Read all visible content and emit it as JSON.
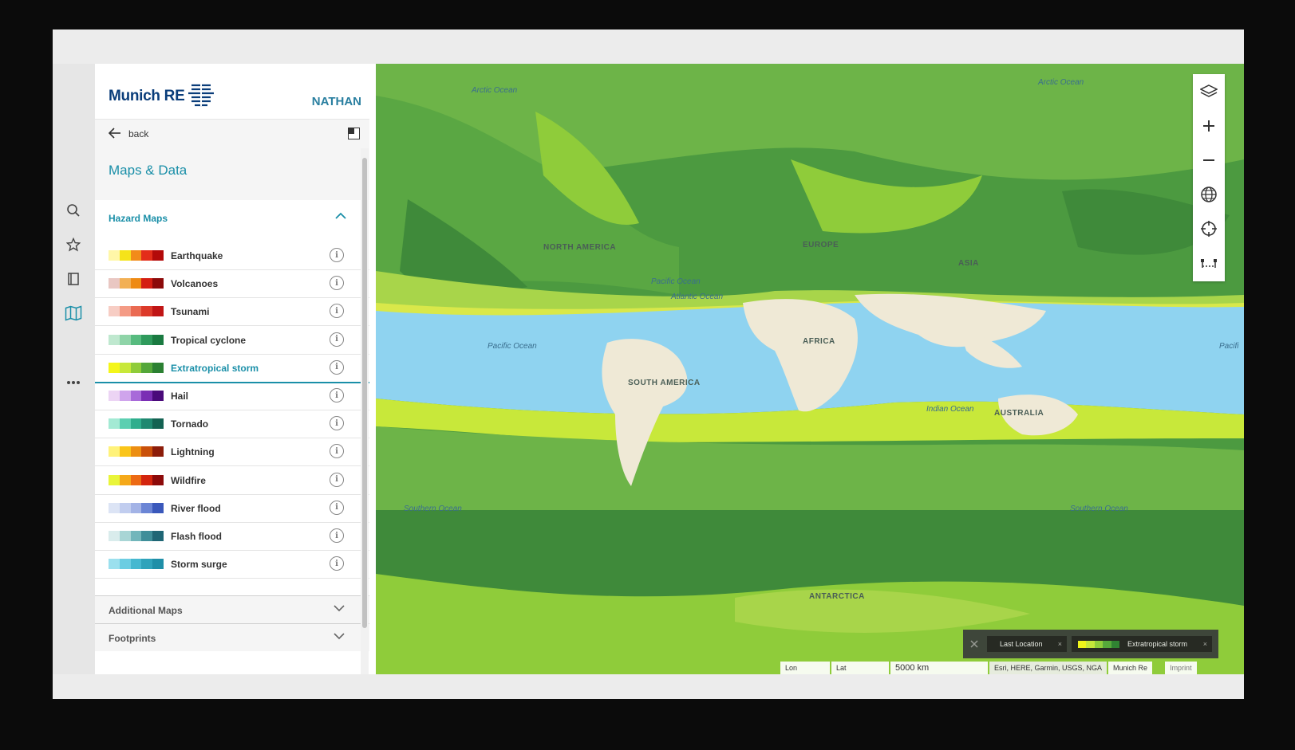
{
  "header": {
    "brand": "Munich RE",
    "user": "NATHAN"
  },
  "nav": {
    "back_label": "back",
    "title": "Maps & Data"
  },
  "hazard_section": {
    "title": "Hazard Maps",
    "items": [
      {
        "label": "Earthquake",
        "colors": [
          "#fff7a8",
          "#f5e31a",
          "#f28b1a",
          "#e32d1a",
          "#b30a0a"
        ]
      },
      {
        "label": "Volcanoes",
        "colors": [
          "#e9c7c2",
          "#f2b055",
          "#ee8a14",
          "#d41e12",
          "#8c0a0a"
        ]
      },
      {
        "label": "Tsunami",
        "colors": [
          "#f7cdc4",
          "#f49b85",
          "#ea6a52",
          "#dc3a2a",
          "#c01515"
        ]
      },
      {
        "label": "Tropical cyclone",
        "colors": [
          "#bfe8cf",
          "#8fd4a8",
          "#57bb7f",
          "#2f9a5c",
          "#1a7a41"
        ]
      },
      {
        "label": "Extratropical storm",
        "colors": [
          "#f4f61a",
          "#c8e83a",
          "#8fcc3a",
          "#54a73a",
          "#2b8032"
        ]
      },
      {
        "label": "Hail",
        "colors": [
          "#ecd4f4",
          "#cfa4ec",
          "#a86ad9",
          "#7a2eb4",
          "#4a0a7a"
        ]
      },
      {
        "label": "Tornado",
        "colors": [
          "#a3ead4",
          "#5ccfb1",
          "#2fae8d",
          "#1f8870",
          "#136252"
        ]
      },
      {
        "label": "Lightning",
        "colors": [
          "#fff27a",
          "#fac51a",
          "#ec8e12",
          "#c9500a",
          "#8c1d0a"
        ]
      },
      {
        "label": "Wildfire",
        "colors": [
          "#e9f53a",
          "#f5a91a",
          "#ec6a14",
          "#d3250e",
          "#8c0a0a"
        ]
      },
      {
        "label": "River flood",
        "colors": [
          "#dce4f5",
          "#c1cdef",
          "#a3b3e6",
          "#6b85d5",
          "#3a58bb"
        ]
      },
      {
        "label": "Flash flood",
        "colors": [
          "#d9ecec",
          "#a8d5d5",
          "#72b6bb",
          "#3f8e99",
          "#1f6675"
        ]
      },
      {
        "label": "Storm surge",
        "colors": [
          "#9be0ee",
          "#6ccde2",
          "#46b8d0",
          "#2fa3bb",
          "#1f8fa8"
        ]
      }
    ]
  },
  "accordions": {
    "additional": "Additional Maps",
    "footprints": "Footprints"
  },
  "map": {
    "regions": [
      "NORTH AMERICA",
      "EUROPE",
      "ASIA",
      "AFRICA",
      "SOUTH AMERICA",
      "AUSTRALIA",
      "ANTARCTICA"
    ],
    "oceans": [
      "Pacific Ocean",
      "Pacific Ocean",
      "Arctic Ocean",
      "Arctic Ocean",
      "Atlantic Ocean",
      "Indian Ocean",
      "Southern Ocean",
      "Southern Ocean"
    ],
    "ocean_crop": "Pacifi"
  },
  "legend": {
    "last_location": "Last Location",
    "layer": "Extratropical storm",
    "layer_colors": [
      "#f4f61a",
      "#c8e83a",
      "#8fcc3a",
      "#54a73a",
      "#2b8032"
    ]
  },
  "status": {
    "lon": "Lon",
    "lat": "Lat",
    "scale": "5000 km",
    "attribution": "Esri, HERE, Garmin, USGS, NGA",
    "credit": "Munich Re",
    "imprint": "Imprint"
  },
  "colors": {
    "accent": "#1a8fa8",
    "brand": "#0a3d7a",
    "ocean_tropics": "#8fd3f0",
    "land": "#efe9d6"
  }
}
